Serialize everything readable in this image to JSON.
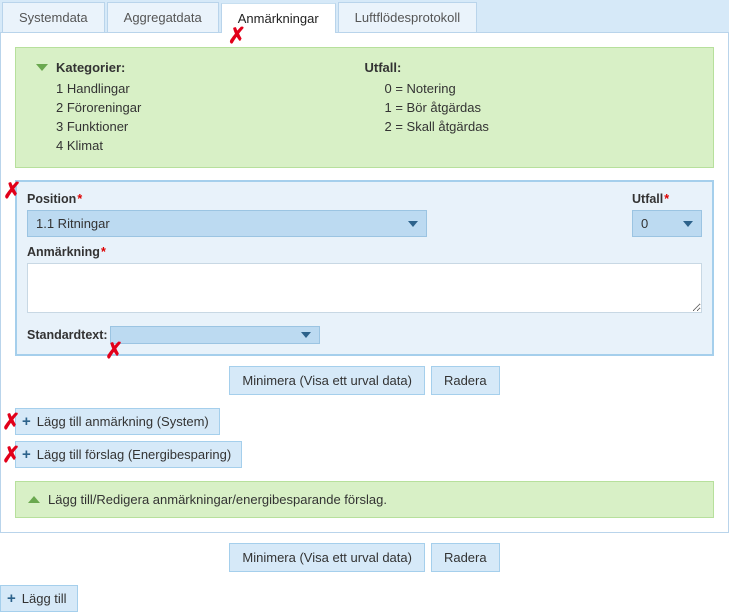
{
  "tabs": {
    "systemdata": "Systemdata",
    "aggregatdata": "Aggregatdata",
    "anmarkningar": "Anmärkningar",
    "luftflodesprotokoll": "Luftflödesprotokoll"
  },
  "legend": {
    "kategorier_heading": "Kategorier:",
    "kat": [
      "1 Handlingar",
      "2 Föroreningar",
      "3 Funktioner",
      "4 Klimat"
    ],
    "utfall_heading": "Utfall:",
    "utfall": [
      "0 = Notering",
      "1 = Bör åtgärdas",
      "2 = Skall åtgärdas"
    ]
  },
  "form": {
    "position_label": "Position",
    "position_value": "1.1 Ritningar",
    "utfall_label": "Utfall",
    "utfall_value": "0",
    "anmarkning_label": "Anmärkning",
    "anmarkning_value": "",
    "standardtext_label": "Standardtext:",
    "standardtext_value": ""
  },
  "buttons": {
    "minimera": "Minimera (Visa ett urval data)",
    "radera": "Radera",
    "lagg_till_system": "Lägg till anmärkning (System)",
    "lagg_till_energi": "Lägg till förslag (Energibesparing)",
    "lagg_till": "Lägg till"
  },
  "info": "Lägg till/Redigera anmärkningar/energibesparande förslag."
}
